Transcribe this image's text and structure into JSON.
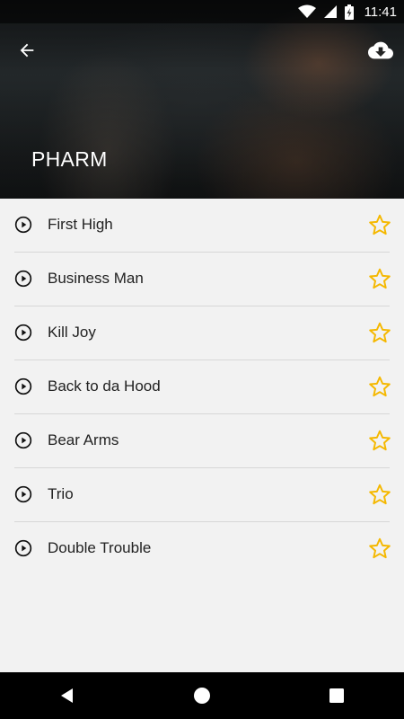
{
  "status_bar": {
    "time": "11:41"
  },
  "header": {
    "title": "PHARM",
    "back_icon": "arrow-left-icon",
    "download_icon": "cloud-download-icon"
  },
  "songs": [
    {
      "title": "First High"
    },
    {
      "title": "Business Man"
    },
    {
      "title": "Kill Joy"
    },
    {
      "title": "Back to da Hood"
    },
    {
      "title": "Bear Arms"
    },
    {
      "title": "Trio"
    },
    {
      "title": "Double Trouble"
    }
  ],
  "colors": {
    "accent_star": "#f5b800",
    "list_background": "#f2f2f2",
    "divider": "#d7d7d7"
  },
  "nav": {
    "back": "nav-back-icon",
    "home": "nav-home-icon",
    "recents": "nav-recents-icon"
  }
}
